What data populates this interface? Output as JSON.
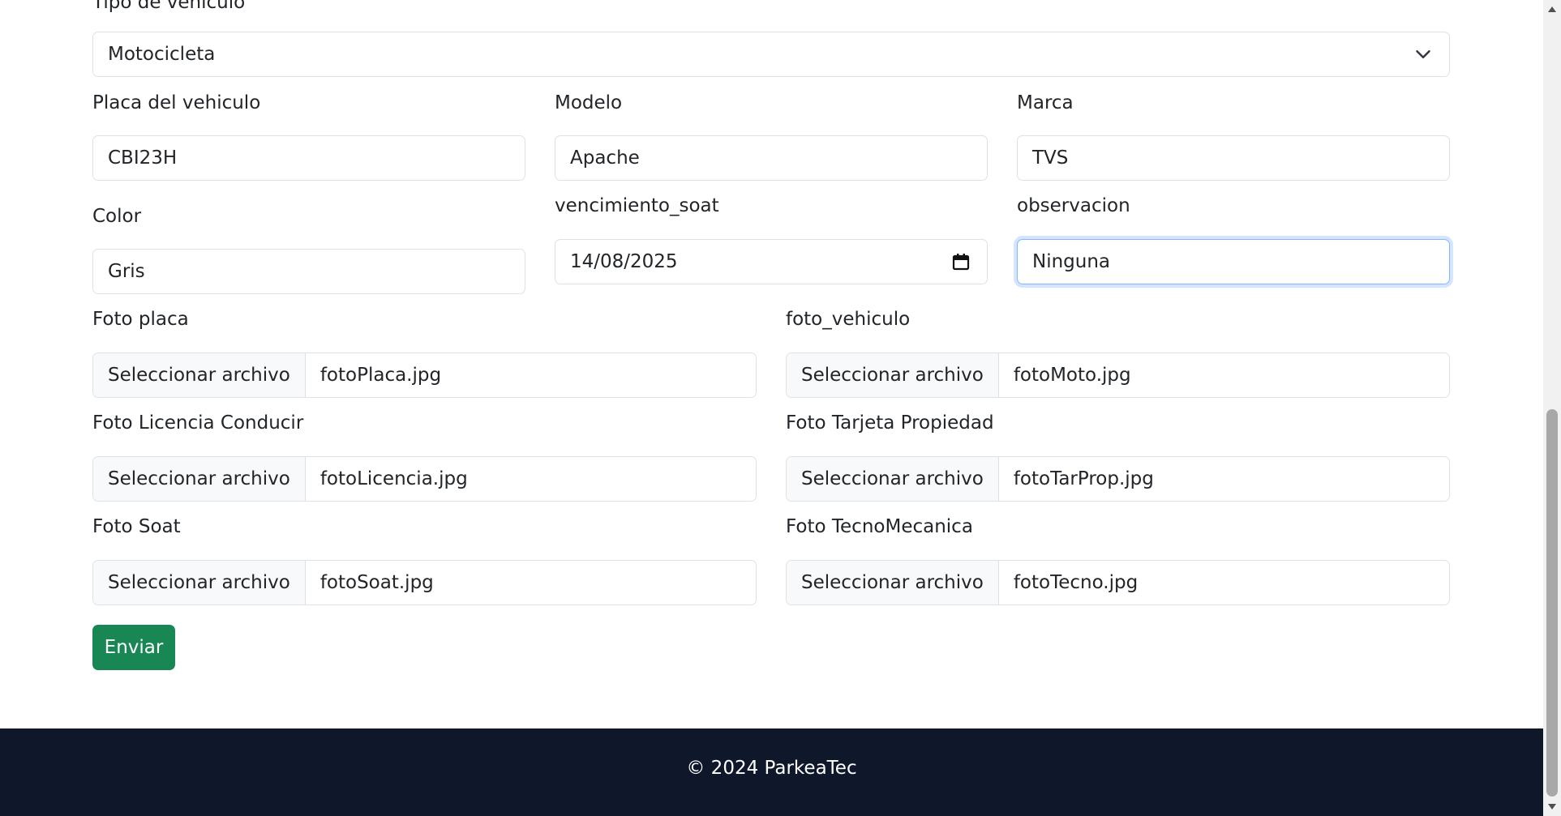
{
  "form": {
    "tipo_vehiculo": {
      "label": "Tipo de vehiculo",
      "value": "Motocicleta",
      "icon": "chevron-down-icon"
    },
    "placa": {
      "label": "Placa del vehiculo",
      "value": "CBI23H"
    },
    "modelo": {
      "label": "Modelo",
      "value": "Apache"
    },
    "marca": {
      "label": "Marca",
      "value": "TVS"
    },
    "color": {
      "label": "Color",
      "value": "Gris"
    },
    "vencimiento_soat": {
      "label": "vencimiento_soat",
      "value": "14/08/2025",
      "icon": "calendar-icon"
    },
    "observacion": {
      "label": "observacion",
      "value": "Ninguna"
    },
    "files": {
      "button_label": "Seleccionar archivo",
      "foto_placa": {
        "label": "Foto placa",
        "file": "fotoPlaca.jpg"
      },
      "foto_vehiculo": {
        "label": "foto_vehiculo",
        "file": "fotoMoto.jpg"
      },
      "foto_licencia": {
        "label": "Foto Licencia Conducir",
        "file": "fotoLicencia.jpg"
      },
      "foto_tarjeta": {
        "label": "Foto Tarjeta Propiedad",
        "file": "fotoTarProp.jpg"
      },
      "foto_soat": {
        "label": "Foto Soat",
        "file": "fotoSoat.jpg"
      },
      "foto_tecno": {
        "label": "Foto TecnoMecanica",
        "file": "fotoTecno.jpg"
      }
    },
    "submit_label": "Enviar"
  },
  "footer": {
    "text": "© 2024 ParkeaTec"
  },
  "colors": {
    "primary_button": "#198754",
    "footer_bg": "#0f172a",
    "focus_border": "#86b7fe",
    "input_border": "#dee2e6"
  }
}
